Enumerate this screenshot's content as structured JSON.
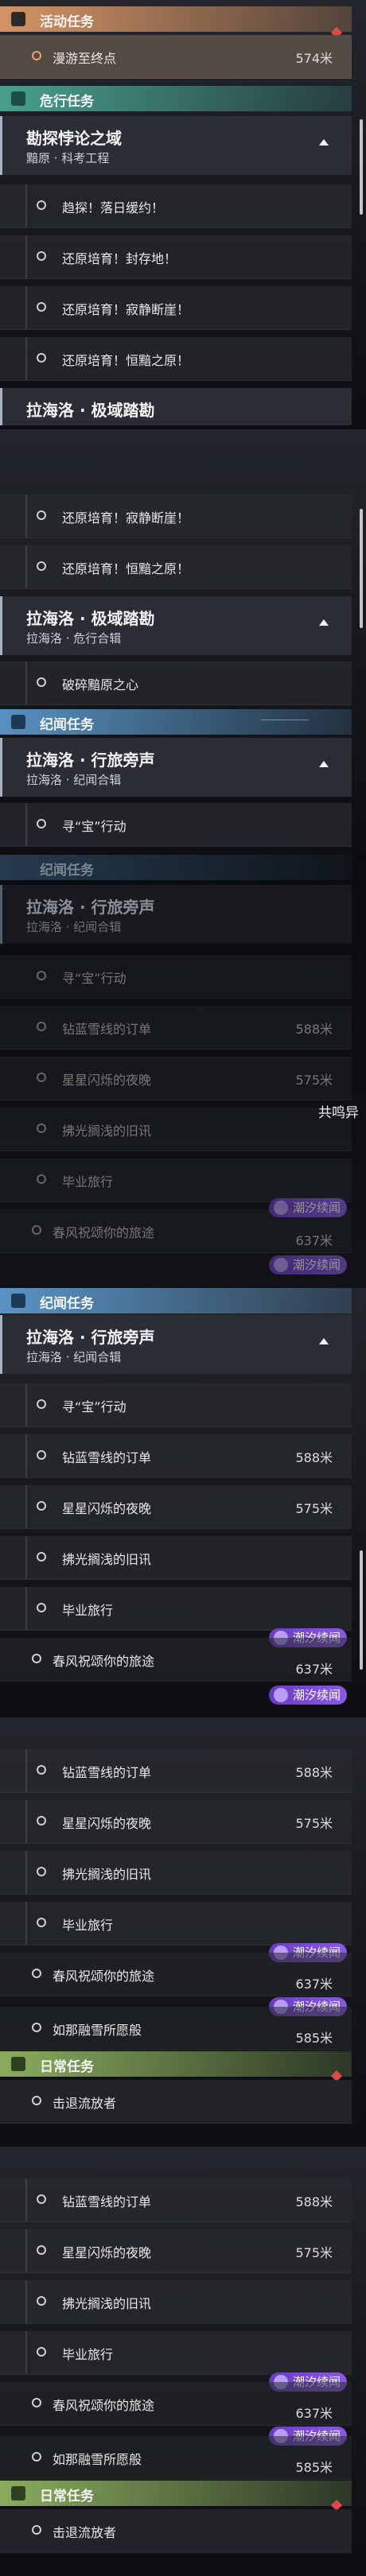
{
  "colors": {
    "activity": "#e8a06a",
    "urgent": "#4fb6a0",
    "chronicle": "#63a7df",
    "daily": "#9fc86a",
    "tag": "#7a4ad6"
  },
  "s1": {
    "activity_title": "活动任务",
    "activity_item": "漫游至终点",
    "activity_dist": "574米",
    "urgent_title": "危行任务",
    "group_title": "勘探悖论之域",
    "group_sub": "黯原 · 科考工程",
    "items": [
      "趋探！落日缓约！",
      "还原培育！封存地！",
      "还原培育！寂静断崖！",
      "还原培育！恒黯之原！"
    ],
    "next_group": "拉海洛 · 极域踏勘"
  },
  "s2": {
    "items_top": [
      "还原培育！寂静断崖！",
      "还原培育！恒黯之原！"
    ],
    "group_title": "拉海洛 · 极域踏勘",
    "group_sub": "拉海洛 · 危行合辑",
    "item": "破碎黯原之心",
    "chronicle_title": "纪闻任务",
    "g2_title": "拉海洛 · 行旅旁声",
    "g2_sub": "拉海洛 · 纪闻合辑",
    "g2_item": "寻“宝”行动"
  },
  "s3": {
    "chronicle_title": "纪闻任务",
    "group_title": "拉海洛 · 行旅旁声",
    "group_sub": "拉海洛 · 纪闻合辑",
    "items": [
      {
        "label": "寻“宝”行动",
        "dist": ""
      },
      {
        "label": "钻蓝雪线的订单",
        "dist": "588米"
      },
      {
        "label": "星星闪烁的夜晚",
        "dist": "575米"
      },
      {
        "label": "拂光搁浅的旧讯",
        "dist": ""
      },
      {
        "label": "毕业旅行",
        "dist": ""
      },
      {
        "label": "春风祝颂你的旅途",
        "dist": "637米"
      }
    ],
    "side_text": "共鸣异",
    "tag": "潮汐续闻"
  },
  "s4": {
    "chronicle_title": "纪闻任务",
    "group_title": "拉海洛 · 行旅旁声",
    "group_sub": "拉海洛 · 纪闻合辑",
    "items": [
      {
        "label": "寻“宝”行动",
        "dist": ""
      },
      {
        "label": "钻蓝雪线的订单",
        "dist": "588米"
      },
      {
        "label": "星星闪烁的夜晚",
        "dist": "575米"
      },
      {
        "label": "拂光搁浅的旧讯",
        "dist": ""
      },
      {
        "label": "毕业旅行",
        "dist": ""
      },
      {
        "label": "春风祝颂你的旅途",
        "dist": "637米"
      }
    ],
    "tag": "潮汐续闻"
  },
  "s5": {
    "items": [
      {
        "label": "钻蓝雪线的订单",
        "dist": "588米"
      },
      {
        "label": "星星闪烁的夜晚",
        "dist": "575米"
      },
      {
        "label": "拂光搁浅的旧讯",
        "dist": ""
      },
      {
        "label": "毕业旅行",
        "dist": ""
      },
      {
        "label": "春风祝颂你的旅途",
        "dist": "637米"
      },
      {
        "label": "如那融雪所愿般",
        "dist": "585米"
      }
    ],
    "tag": "潮汐续闻",
    "daily_title": "日常任务",
    "daily_item": "击退流放者"
  },
  "s6": {
    "items": [
      {
        "label": "钻蓝雪线的订单",
        "dist": "588米"
      },
      {
        "label": "星星闪烁的夜晚",
        "dist": "575米"
      },
      {
        "label": "拂光搁浅的旧讯",
        "dist": ""
      },
      {
        "label": "毕业旅行",
        "dist": ""
      },
      {
        "label": "春风祝颂你的旅途",
        "dist": "637米"
      },
      {
        "label": "如那融雪所愿般",
        "dist": "585米"
      }
    ],
    "tag": "潮汐续闻",
    "daily_title": "日常任务",
    "daily_item": "击退流放者"
  }
}
